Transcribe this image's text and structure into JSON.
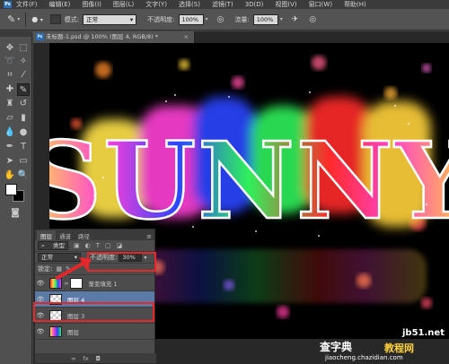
{
  "menubar": {
    "logo": "Ps",
    "items": [
      "文件(F)",
      "编辑(E)",
      "图像(I)",
      "图层(L)",
      "文字(Y)",
      "选择(S)",
      "滤镜(T)",
      "3D(D)",
      "视图(V)",
      "窗口(W)",
      "帮助(H)"
    ]
  },
  "options": {
    "mode_label": "模式:",
    "mode_value": "正常",
    "opacity_label": "不透明度:",
    "opacity_value": "100%",
    "flow_label": "流量:",
    "flow_value": "100%"
  },
  "doc_tab": {
    "title": "未标题-1.psd @ 100% (图层 4, RGB/8) *",
    "close": "×",
    "icon": "Ps"
  },
  "artwork": {
    "text": "SUNNY"
  },
  "layers_panel": {
    "tabs": [
      "图层",
      "通道",
      "路径"
    ],
    "filter_value": "类型",
    "blend_value": "正常",
    "opacity_label": "不透明度:",
    "opacity_value": "30%",
    "lock_label": "锁定:",
    "layers": [
      {
        "name": "渐变填充 1",
        "type": "gradient"
      },
      {
        "name": "图层 4",
        "type": "pixel",
        "selected": true
      },
      {
        "name": "图层 3",
        "type": "pixel"
      },
      {
        "name": "图层",
        "type": "pixel"
      }
    ],
    "footer_fx": "fx"
  },
  "watermarks": {
    "site": "jb51.net",
    "brand": "教程网",
    "tag": "查字典",
    "url": "jiaocheng.chazidian.com"
  },
  "colors": {
    "highlight_box": "#e3272b",
    "selected_layer": "#5b7aa8",
    "brand_blue": "#2c6fb6"
  }
}
